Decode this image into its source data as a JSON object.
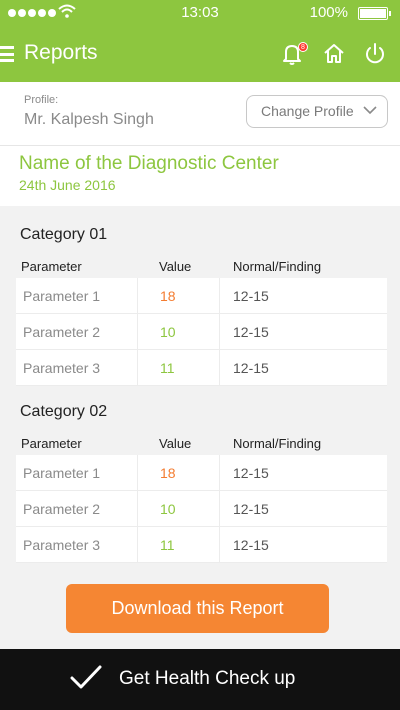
{
  "status_bar": {
    "time": "13:03",
    "battery": "100%"
  },
  "header": {
    "title": "Reports",
    "notification_count": "8"
  },
  "profile": {
    "label": "Profile:",
    "name": "Mr. Kalpesh Singh",
    "change_button": "Change Profile"
  },
  "center": {
    "name": "Name of the Diagnostic Center",
    "date": "24th June 2016"
  },
  "table_headers": {
    "parameter": "Parameter",
    "value": "Value",
    "normal": "Normal/Finding"
  },
  "categories": [
    {
      "title": "Category 01",
      "rows": [
        {
          "parameter": "Parameter 1",
          "value": "18",
          "normal": "12-15",
          "status": "high"
        },
        {
          "parameter": "Parameter 2",
          "value": "10",
          "normal": "12-15",
          "status": "ok"
        },
        {
          "parameter": "Parameter 3",
          "value": "11",
          "normal": "12-15",
          "status": "ok"
        }
      ]
    },
    {
      "title": "Category 02",
      "rows": [
        {
          "parameter": "Parameter 1",
          "value": "18",
          "normal": "12-15",
          "status": "high"
        },
        {
          "parameter": "Parameter 2",
          "value": "10",
          "normal": "12-15",
          "status": "ok"
        },
        {
          "parameter": "Parameter 3",
          "value": "11",
          "normal": "12-15",
          "status": "ok"
        }
      ]
    }
  ],
  "download_button": "Download this Report",
  "footer": {
    "label": "Get Health Check up"
  },
  "colors": {
    "accent": "#8dc63f",
    "orange": "#f58633",
    "high_value": "#f47c30",
    "footer_bg": "#111111"
  }
}
